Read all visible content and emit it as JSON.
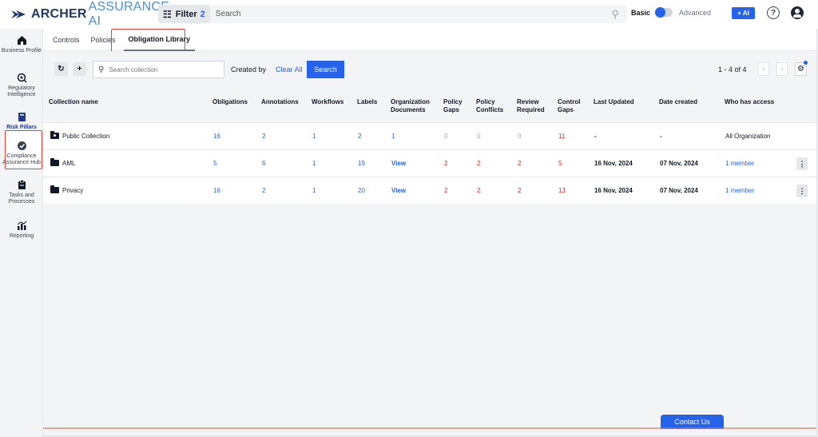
{
  "brand": {
    "name_bold": "ARCHER",
    "name_light": "ASSURANCE AI"
  },
  "header": {
    "filter_label": "Filter",
    "filter_count": "2",
    "search_placeholder": "Search",
    "mode_basic": "Basic",
    "mode_advanced": "Advanced",
    "ai_button": "+ AI",
    "help_icon": "question-circle-icon",
    "user_icon": "account-circle-icon",
    "accent_color": "#2563eb"
  },
  "sidebar": {
    "items": [
      {
        "label": "Business Profile",
        "icon": "building-icon"
      },
      {
        "label": "Regulatory Intelligence",
        "icon": "target-search-icon"
      },
      {
        "label": "Risk Pillars",
        "icon": "book-icon",
        "active": true
      },
      {
        "label": "Compliance Assurance Hub",
        "icon": "shield-check-icon"
      },
      {
        "label": "Tasks and Processes",
        "icon": "clipboard-icon"
      },
      {
        "label": "Reporting",
        "icon": "chart-icon"
      }
    ]
  },
  "tabs": [
    "Controls",
    "Policies",
    "Obligation Library"
  ],
  "active_tab": "Obligation Library",
  "toolbar": {
    "refresh_icon": "refresh-icon",
    "add_icon": "plus-icon",
    "search_placeholder": "Search collection",
    "created_by": "Created by",
    "clear_all": "Clear All",
    "search_button": "Search",
    "pagination": "1 - 4 of 4",
    "prev": "‹",
    "next": "›",
    "settings_icon": "gear-icon"
  },
  "table": {
    "columns": [
      "Collection name",
      "Obligations",
      "Annotations",
      "Workflows",
      "Labels",
      "Organization Documents",
      "Policy Gaps",
      "Policy Conflicts",
      "Review Required",
      "Control Gaps",
      "Last Updated",
      "Date created",
      "Who has access"
    ],
    "rows": [
      {
        "name": "Public Collection",
        "obligations": "16",
        "annotations": "2",
        "workflows": "1",
        "labels": "2",
        "org_docs": "1",
        "policy_gaps": "0",
        "policy_conflicts": "0",
        "review_required": "0",
        "control_gaps": "11",
        "last_updated": "-",
        "date_created": "-",
        "access": "All Organization"
      },
      {
        "name": "AML",
        "obligations": "5",
        "annotations": "6",
        "workflows": "1",
        "labels": "19",
        "org_docs": "View",
        "policy_gaps": "2",
        "policy_conflicts": "2",
        "review_required": "2",
        "control_gaps": "5",
        "last_updated": "16 Nov, 2024",
        "date_created": "07 Nov, 2024",
        "access": "1 member"
      },
      {
        "name": "Privacy",
        "obligations": "16",
        "annotations": "2",
        "workflows": "1",
        "labels": "20",
        "org_docs": "View",
        "policy_gaps": "2",
        "policy_conflicts": "2",
        "review_required": "2",
        "control_gaps": "13",
        "last_updated": "16 Nov, 2024",
        "date_created": "07 Nov, 2024",
        "access": "1 member"
      }
    ]
  },
  "contact_button": "Contact Us"
}
